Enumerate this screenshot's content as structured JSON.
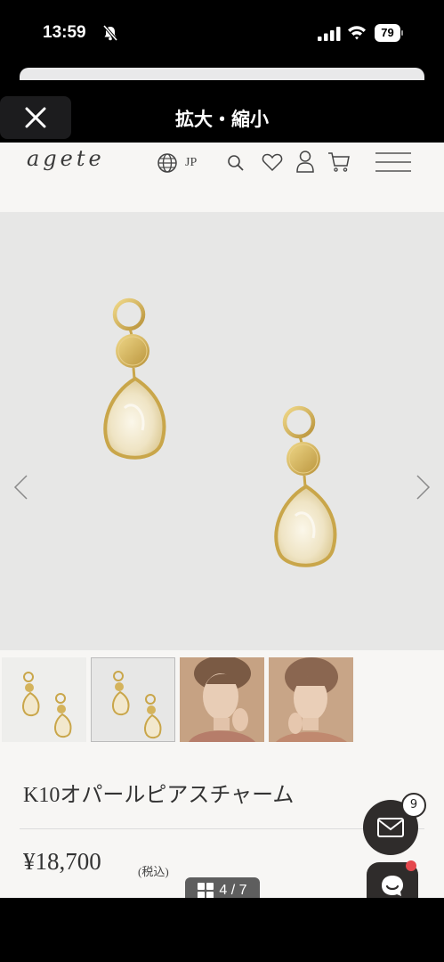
{
  "status_bar": {
    "time": "13:59",
    "battery": "79",
    "icons": [
      "mute-icon",
      "signal-icon",
      "wifi-icon",
      "battery-icon"
    ]
  },
  "viewer": {
    "title": "拡大・縮小",
    "close_icon": "close-icon",
    "page_indicator": "4 / 7"
  },
  "site": {
    "logo": "agete",
    "language": "JP",
    "header_icons": [
      "globe-icon",
      "search-icon",
      "heart-icon",
      "user-icon",
      "cart-icon",
      "menu-icon"
    ]
  },
  "product": {
    "name": "K10オパールピアスチャーム",
    "price": "¥18,700",
    "tax_note": "(税込)",
    "thumbnail_count": 4
  },
  "floating": {
    "mail_badge_count": "9"
  },
  "colors": {
    "gold": "#d4b35c",
    "opal": "#f4ecd8",
    "dark_fab": "#2f2c2b",
    "page_bg": "#f7f6f4"
  }
}
